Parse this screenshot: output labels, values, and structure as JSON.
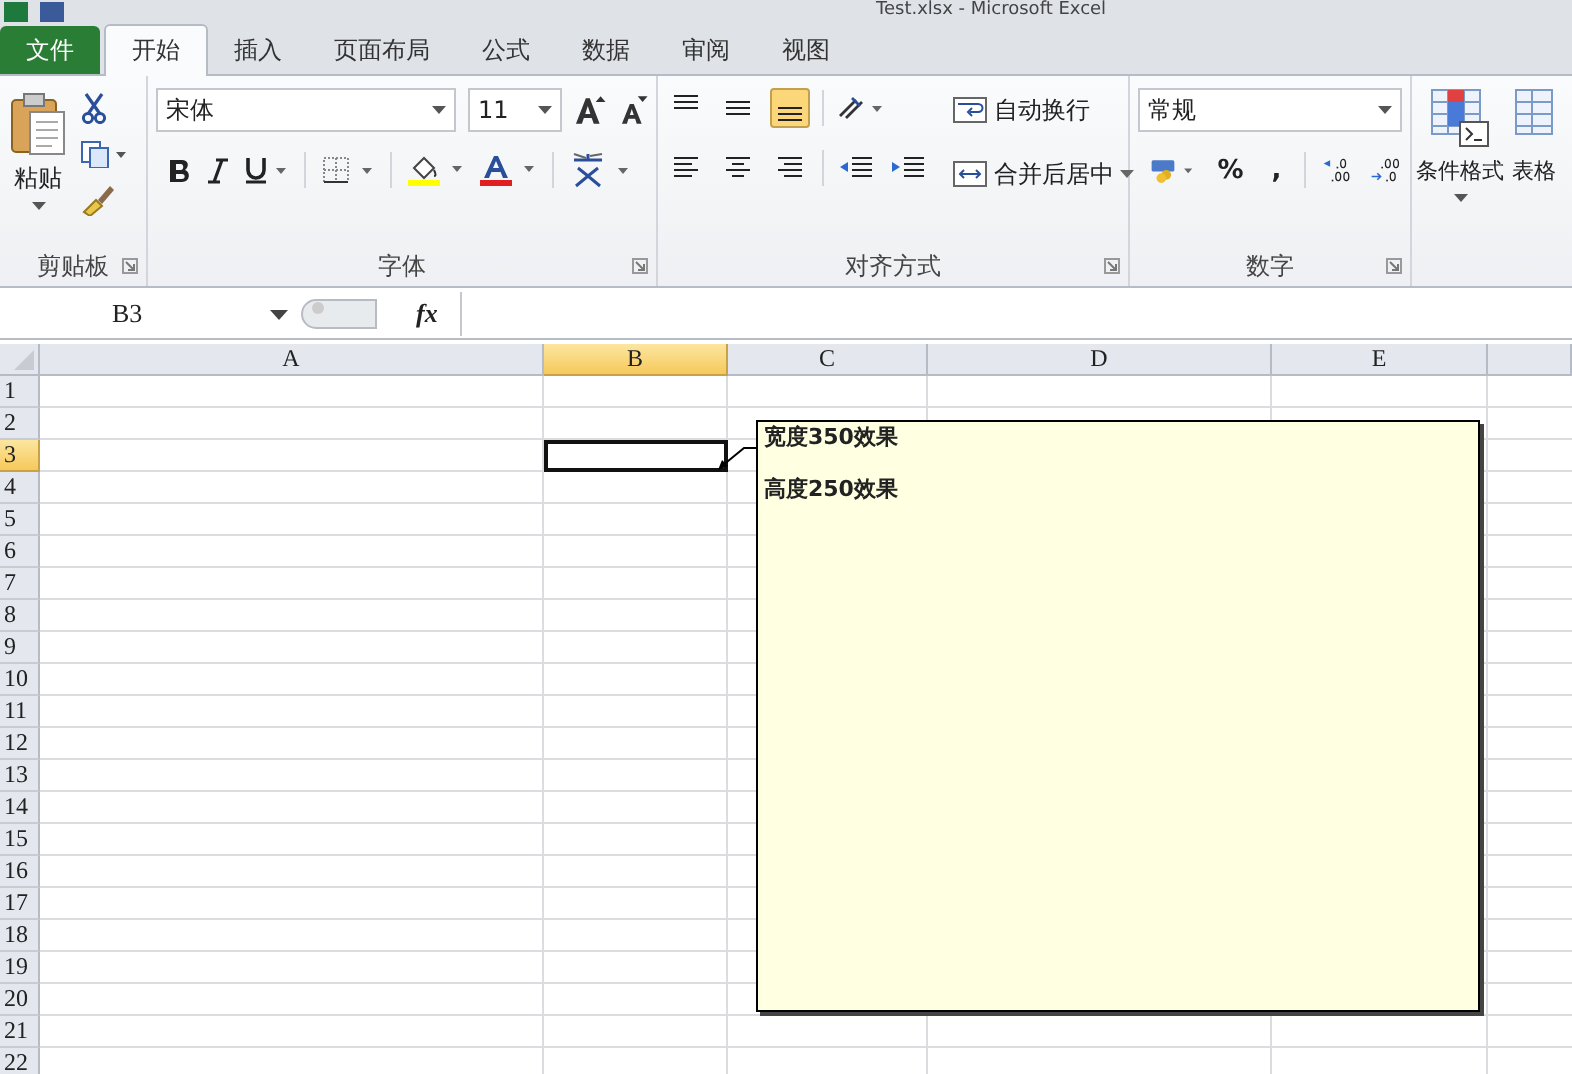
{
  "window": {
    "title": "Test.xlsx  -  Microsoft Excel"
  },
  "tabs": [
    {
      "label": "文件",
      "kind": "file",
      "selected": false
    },
    {
      "label": "开始",
      "kind": "tab",
      "selected": true
    },
    {
      "label": "插入",
      "kind": "tab",
      "selected": false
    },
    {
      "label": "页面布局",
      "kind": "tab",
      "selected": false
    },
    {
      "label": "公式",
      "kind": "tab",
      "selected": false
    },
    {
      "label": "数据",
      "kind": "tab",
      "selected": false
    },
    {
      "label": "审阅",
      "kind": "tab",
      "selected": false
    },
    {
      "label": "视图",
      "kind": "tab",
      "selected": false
    }
  ],
  "clipboard": {
    "paste": "粘贴",
    "label": "剪贴板"
  },
  "font": {
    "name": "宋体",
    "size": "11",
    "label": "字体"
  },
  "alignment": {
    "label": "对齐方式",
    "wrap": "自动换行",
    "merge": "合并后居中",
    "vertical": [
      {
        "kind": "top",
        "selected": false
      },
      {
        "kind": "middle",
        "selected": false
      },
      {
        "kind": "bottom",
        "selected": true
      }
    ],
    "horizontal": [
      {
        "kind": "left",
        "selected": false
      },
      {
        "kind": "center",
        "selected": false
      },
      {
        "kind": "right",
        "selected": false
      }
    ]
  },
  "number": {
    "format": "常规",
    "percent": "%",
    "comma": ",",
    "label": "数字"
  },
  "styles": {
    "conditional": "条件格式",
    "table": "表格"
  },
  "formula_bar": {
    "name_box": "B3",
    "fx": "fx"
  },
  "sheet": {
    "columns": [
      {
        "label": "A",
        "selected": false
      },
      {
        "label": "B",
        "selected": true
      },
      {
        "label": "C",
        "selected": false
      },
      {
        "label": "D",
        "selected": false
      },
      {
        "label": "E",
        "selected": false
      }
    ],
    "rows": [
      {
        "label": "1",
        "selected": false
      },
      {
        "label": "2",
        "selected": false
      },
      {
        "label": "3",
        "selected": true
      },
      {
        "label": "4",
        "selected": false
      },
      {
        "label": "5",
        "selected": false
      },
      {
        "label": "6",
        "selected": false
      },
      {
        "label": "7",
        "selected": false
      },
      {
        "label": "8",
        "selected": false
      },
      {
        "label": "9",
        "selected": false
      },
      {
        "label": "10",
        "selected": false
      },
      {
        "label": "11",
        "selected": false
      },
      {
        "label": "12",
        "selected": false
      },
      {
        "label": "13",
        "selected": false
      },
      {
        "label": "14",
        "selected": false
      },
      {
        "label": "15",
        "selected": false
      },
      {
        "label": "16",
        "selected": false
      },
      {
        "label": "17",
        "selected": false
      },
      {
        "label": "18",
        "selected": false
      },
      {
        "label": "19",
        "selected": false
      },
      {
        "label": "20",
        "selected": false
      },
      {
        "label": "21",
        "selected": false
      },
      {
        "label": "22",
        "selected": false
      }
    ],
    "comment": {
      "lines": [
        "宽度350效果",
        "高度250效果"
      ]
    }
  }
}
